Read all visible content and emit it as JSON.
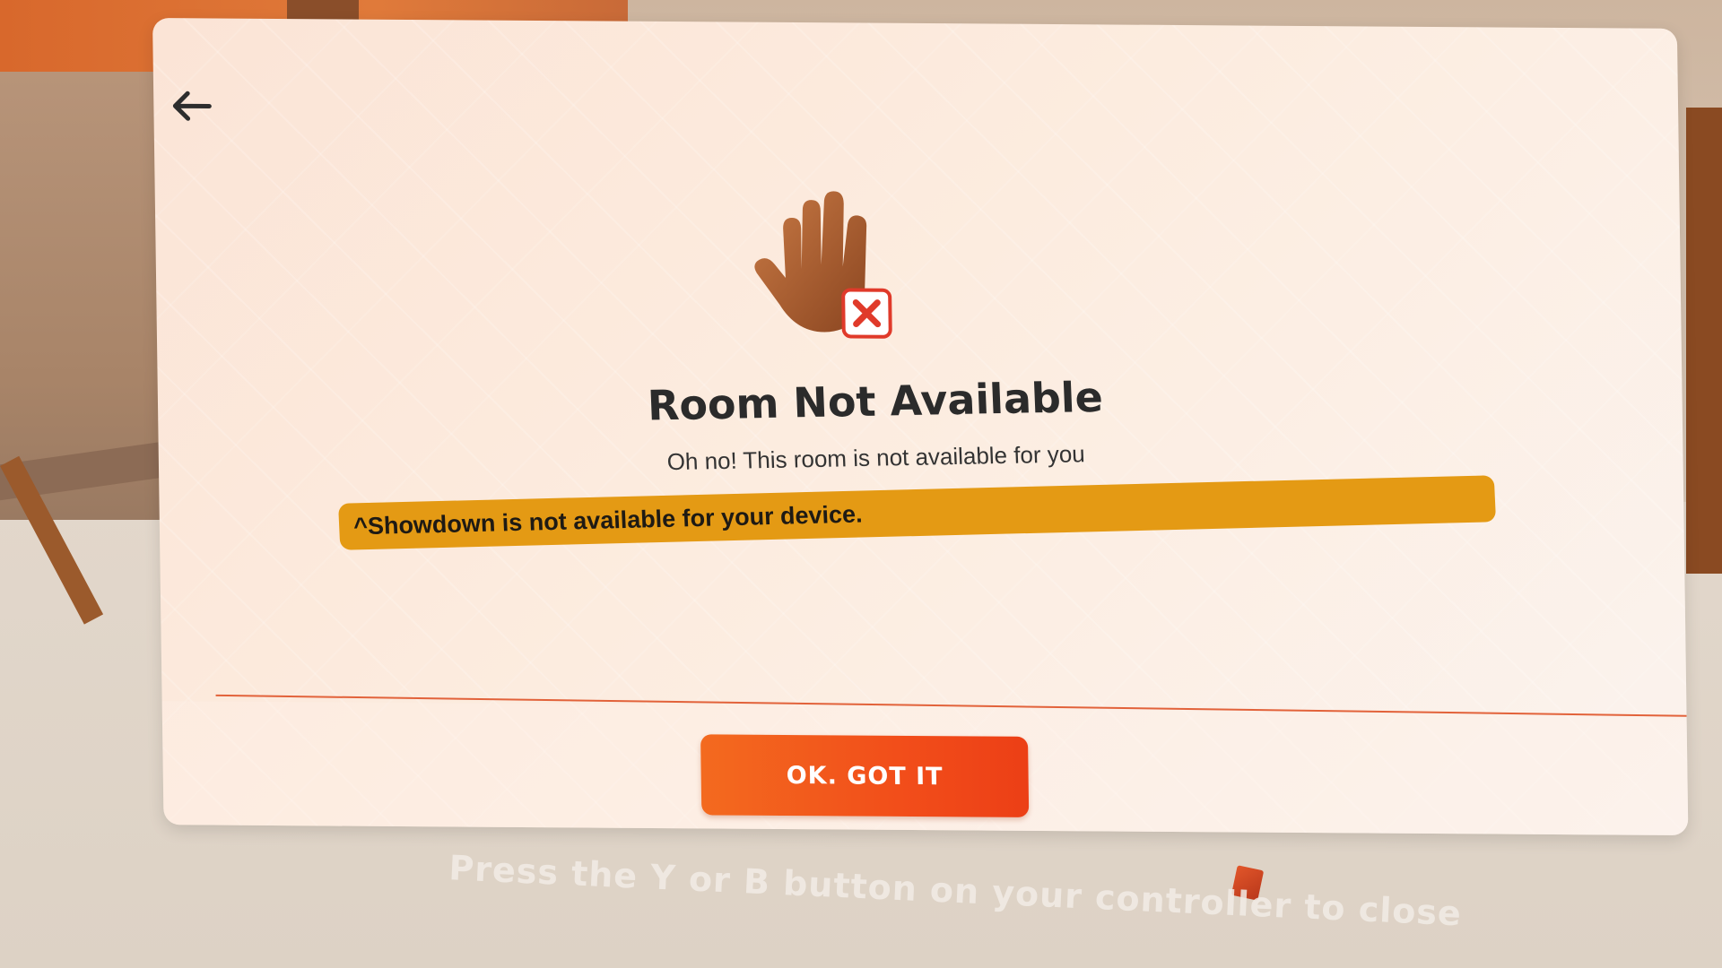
{
  "dialog": {
    "title": "Room Not Available",
    "subtitle": "Oh no! This room is not available for you",
    "warning": "^Showdown is not available for your device.",
    "ok_button_label": "OK. GOT IT",
    "back_icon": "arrow-left-icon",
    "illustration_icon": "hand-stop-icon",
    "badge_icon": "close-icon"
  },
  "hint": {
    "text": "Press the Y or B button on your controller to close"
  },
  "colors": {
    "accent": "#f24e1a",
    "warning_bar": "#e49a14",
    "panel_bg": "#fbe4d6",
    "title_text": "#2b2b2b"
  }
}
